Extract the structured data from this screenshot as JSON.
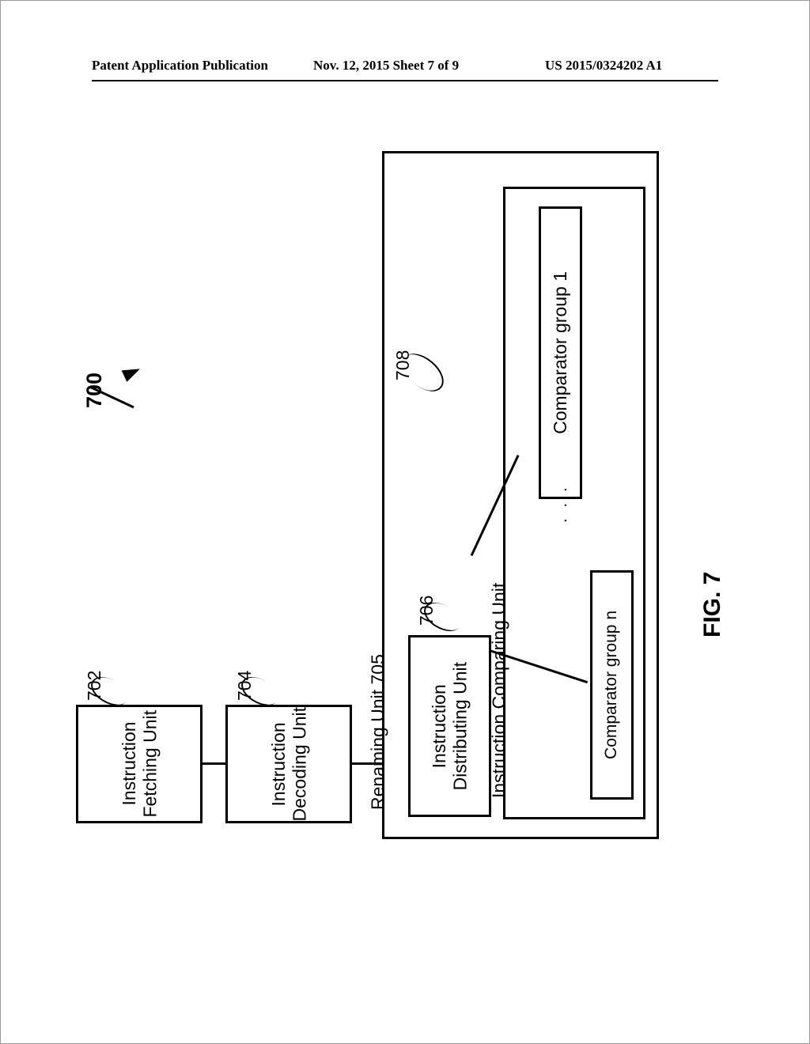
{
  "header": {
    "left": "Patent Application Publication",
    "mid": "Nov. 12, 2015  Sheet 7 of 9",
    "right": "US 2015/0324202 A1"
  },
  "figure": {
    "ref": "700",
    "caption": "FIG. 7"
  },
  "blocks": {
    "fetching": {
      "ref": "702",
      "label": "Instruction\nFetching Unit"
    },
    "decoding": {
      "ref": "704",
      "label": "Instruction\nDecoding Unit"
    },
    "renaming": {
      "ref": "",
      "label": "Renaming Unit 705"
    },
    "distributing": {
      "ref": "706",
      "label": "Instruction\nDistributing Unit"
    },
    "comparing": {
      "ref": "708",
      "label": "Instruction Comparing Unit"
    },
    "groups": {
      "first": "Comparator group 1",
      "last": "Comparator group n"
    }
  }
}
